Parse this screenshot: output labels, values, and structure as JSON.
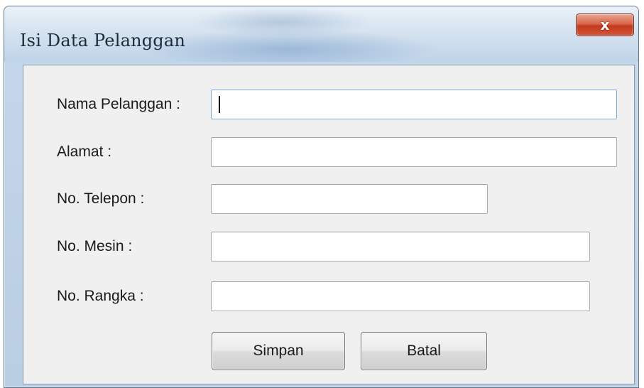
{
  "window": {
    "title": "Isi Data Pelanggan",
    "close_glyph": "x"
  },
  "form": {
    "fields": [
      {
        "label": "Nama Pelanggan :",
        "value": "",
        "placeholder": ""
      },
      {
        "label": "Alamat :",
        "value": "",
        "placeholder": ""
      },
      {
        "label": "No. Telepon :",
        "value": "",
        "placeholder": ""
      },
      {
        "label": "No. Mesin :",
        "value": "",
        "placeholder": ""
      },
      {
        "label": "No. Rangka :",
        "value": "",
        "placeholder": ""
      }
    ]
  },
  "buttons": {
    "save_label": "Simpan",
    "cancel_label": "Batal"
  },
  "colors": {
    "close_button": "#c2391c",
    "titlebar": "#c0d4e8",
    "client_background": "#f0f0f0"
  },
  "icons": {
    "close": "close-icon"
  }
}
